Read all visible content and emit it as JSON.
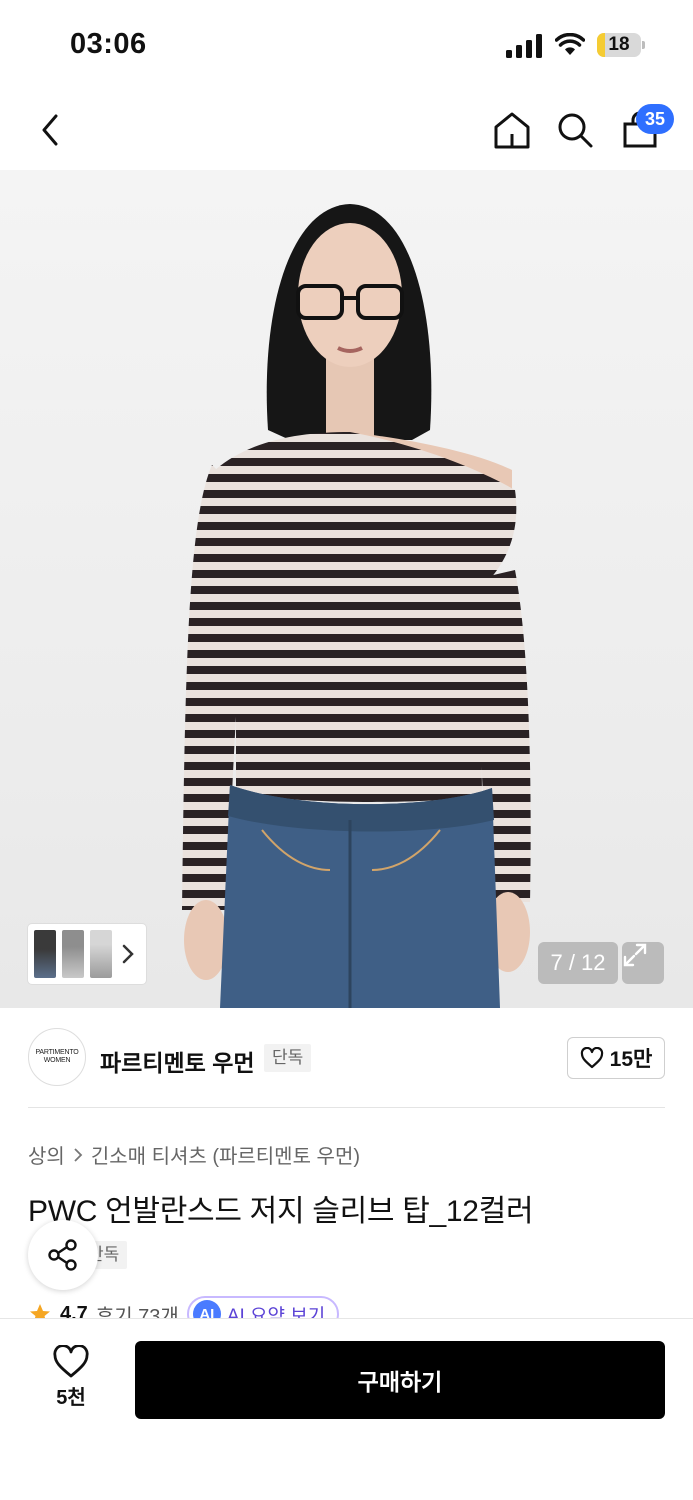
{
  "status_bar": {
    "time": "03:06",
    "battery_level": "18",
    "battery_fraction": 0.18,
    "icons": [
      "signal-icon",
      "wifi-icon",
      "battery-icon"
    ]
  },
  "nav": {
    "icons": [
      "back-icon",
      "home-icon",
      "search-icon",
      "cart-icon"
    ],
    "cart_count": "35"
  },
  "gallery": {
    "page_indicator": "7 / 12",
    "thumbnail_count": 3
  },
  "brand": {
    "logo_line1": "PARTIMENTO",
    "logo_line2": "WOMEN",
    "name": "파르티멘토 우먼",
    "tag": "단독",
    "like_count": "15만"
  },
  "product": {
    "breadcrumb": [
      "상의",
      "긴소매 티셔츠 (파르티멘토 우먼)"
    ],
    "title": "PWC 언발란스드 저지 슬리브 탑_12컬러",
    "tag": "단독",
    "rating": "4.7",
    "reviews": "후기 73개",
    "ai_badge": "AI",
    "ai_summary": "AI 요약 보기"
  },
  "bottom_bar": {
    "wish_count": "5천",
    "buy_label": "구매하기"
  },
  "colors": {
    "accent_blue": "#2f6fff",
    "buy_button": "#000000",
    "ai_purple": "#5b43d6",
    "star": "#f5a623"
  }
}
